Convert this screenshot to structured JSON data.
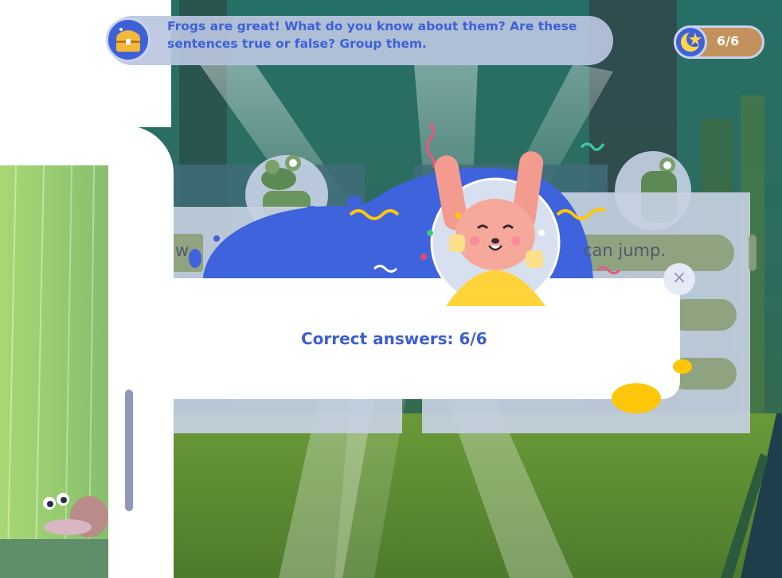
{
  "instruction": {
    "text": "Frogs are great! What do you know about them? Are these sentences true or false? Group them."
  },
  "score": {
    "label": "6/6"
  },
  "result": {
    "label": "Correct answers: 6/6"
  },
  "close": {
    "glyph": "×"
  },
  "background_cards": {
    "left_fragment": "w",
    "right_fragment": "can jump."
  },
  "colors": {
    "accent": "#3e61d8",
    "yellow": "#ffc60a",
    "score_pill": "#c3915b"
  },
  "icons": [
    "treasure-chest-icon",
    "star-moon-icon",
    "close-icon",
    "snail-icon",
    "frog-icon",
    "bunny-mascot"
  ]
}
